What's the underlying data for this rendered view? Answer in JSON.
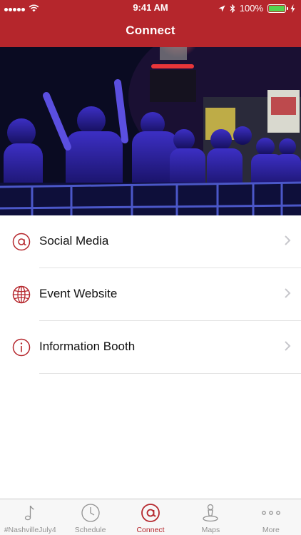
{
  "status_bar": {
    "time": "9:41 AM",
    "battery": "100%",
    "battery_level": 1.0
  },
  "nav": {
    "title": "Connect"
  },
  "hero": {
    "icon": "concert-crowd-photo"
  },
  "list": {
    "items": [
      {
        "label": "Social Media",
        "icon": "at-sign-icon"
      },
      {
        "label": "Event Website",
        "icon": "globe-icon"
      },
      {
        "label": "Information Booth",
        "icon": "info-icon"
      }
    ]
  },
  "tabbar": {
    "tabs": [
      {
        "label": "#NashvilleJuly4",
        "icon": "music-note-icon",
        "active": false
      },
      {
        "label": "Schedule",
        "icon": "clock-icon",
        "active": false
      },
      {
        "label": "Connect",
        "icon": "at-sign-icon",
        "active": true
      },
      {
        "label": "Maps",
        "icon": "map-pin-icon",
        "active": false
      },
      {
        "label": "More",
        "icon": "more-dots-icon",
        "active": false
      }
    ]
  },
  "colors": {
    "brand_red": "#b5262c",
    "inactive_gray": "#929292",
    "chevron": "#c7c7cc",
    "battery_green": "#54d24f"
  }
}
